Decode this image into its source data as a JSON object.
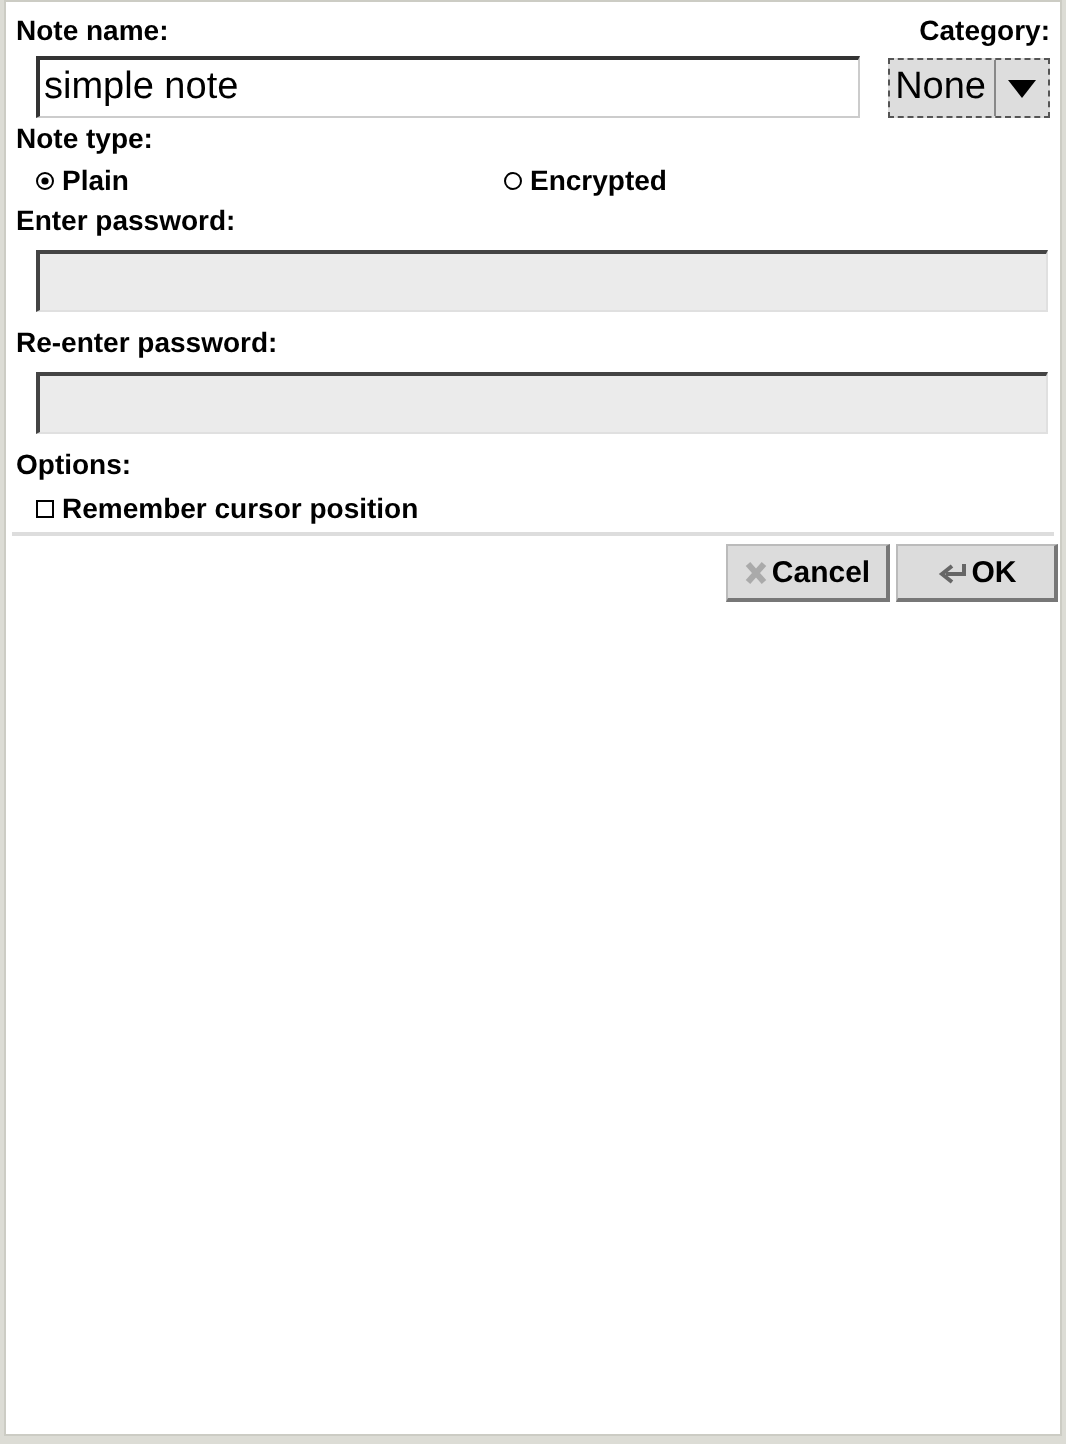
{
  "note_name": {
    "label": "Note name:",
    "value": "simple note"
  },
  "category": {
    "label": "Category:",
    "value": "None"
  },
  "note_type": {
    "label": "Note type:",
    "options": [
      {
        "label": "Plain",
        "selected": true
      },
      {
        "label": "Encrypted",
        "selected": false
      }
    ]
  },
  "password_fields": [
    {
      "label": "Enter password:",
      "disabled": true
    },
    {
      "label": "Re-enter password:",
      "disabled": true
    }
  ],
  "options": {
    "label": "Options:",
    "items": [
      {
        "label": "Remember cursor position",
        "checked": false
      }
    ]
  },
  "buttons": [
    {
      "label": "Cancel",
      "kind": "cancel"
    },
    {
      "label": "OK",
      "kind": "ok"
    }
  ]
}
